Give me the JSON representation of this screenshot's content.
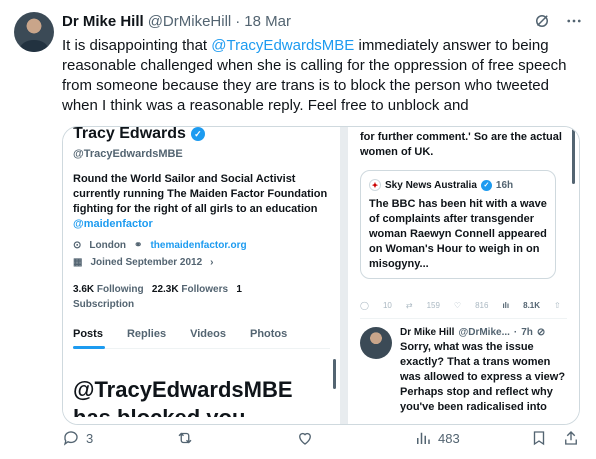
{
  "author": {
    "name": "Dr Mike Hill",
    "handle": "@DrMikeHill",
    "separator": "·",
    "date": "18 Mar"
  },
  "tweet": {
    "text_before": "It is disappointing that ",
    "mention": "@TracyEdwardsMBE",
    "text_after": " immediately answer to being reasonable challenged when she is calling for the oppression of free speech from someone because they are trans is to block the person who tweeted when I think was a reasonable reply. Feel free to unblock and"
  },
  "left_image": {
    "name": "Tracy Edwards",
    "handle": "@TracyEdwardsMBE",
    "bio_text": "Round the World Sailor and Social Activist currently running The Maiden Factor Foundation fighting for the right of all girls to an education ",
    "bio_mention": "@maidenfactor",
    "location": "London",
    "website": "themaidenfactor.org",
    "joined": "Joined September 2012",
    "following_count": "3.6K",
    "following_label": "Following",
    "followers_count": "22.3K",
    "followers_label": "Followers",
    "subscription_count": "1",
    "subscription_label": "Subscription",
    "tabs": [
      "Posts",
      "Replies",
      "Videos",
      "Photos"
    ],
    "blocked_heading": "@TracyEdwardsMBE",
    "blocked_sub": "has blocked you"
  },
  "right_image": {
    "top_text": "for further comment.' So are the actual women of UK.",
    "quote_source": "Sky News Australia",
    "quote_time": "16h",
    "quote_body": "The BBC has been hit with a wave of complaints after transgender woman Raewyn Connell appeared on Woman's Hour to weigh in on misogyny...",
    "faint_replies": "10",
    "faint_reposts": "159",
    "faint_likes": "816",
    "faint_views": "8.1K",
    "reply_name": "Dr Mike Hill",
    "reply_handle": "@DrMike...",
    "reply_time": "7h",
    "reply_body": "Sorry, what was the issue exactly? That a trans women was allowed to express a view? Perhaps stop and reflect why you've been radicalised into"
  },
  "footer": {
    "replies": "3",
    "views": "483"
  },
  "icons": [
    "grok-icon",
    "more-icon",
    "reply-icon",
    "repost-icon",
    "like-icon",
    "views-icon",
    "bookmark-icon",
    "share-icon"
  ],
  "colors": {
    "accent": "#1d9bf0",
    "muted": "#536471",
    "text": "#0f1419"
  }
}
